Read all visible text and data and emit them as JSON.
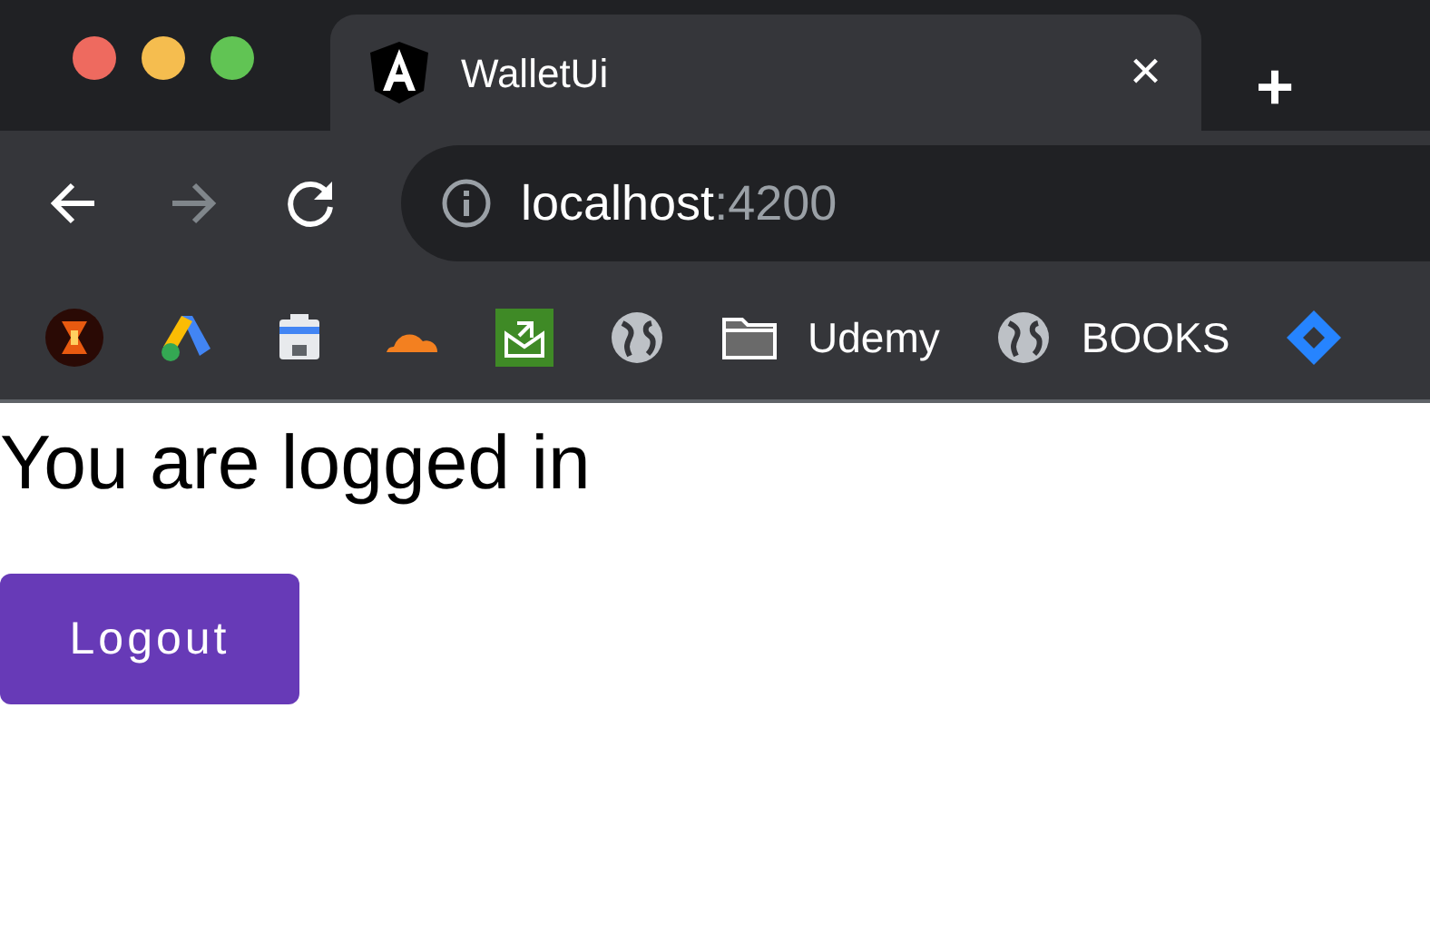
{
  "tab": {
    "title": "WalletUi",
    "close": "×",
    "selected": true
  },
  "new_tab": "+",
  "toolbar": {
    "forward_disabled": true,
    "address_host": "localhost",
    "address_port": ":4200"
  },
  "bookmarks": [
    {
      "kind": "hourglass"
    },
    {
      "kind": "ads"
    },
    {
      "kind": "console"
    },
    {
      "kind": "cloud"
    },
    {
      "kind": "mail"
    },
    {
      "kind": "globe"
    },
    {
      "kind": "folder",
      "label": "Udemy"
    },
    {
      "kind": "globe",
      "label": "BOOKS"
    },
    {
      "kind": "diamond"
    }
  ],
  "page": {
    "message": "You are logged in",
    "button": "Logout"
  }
}
